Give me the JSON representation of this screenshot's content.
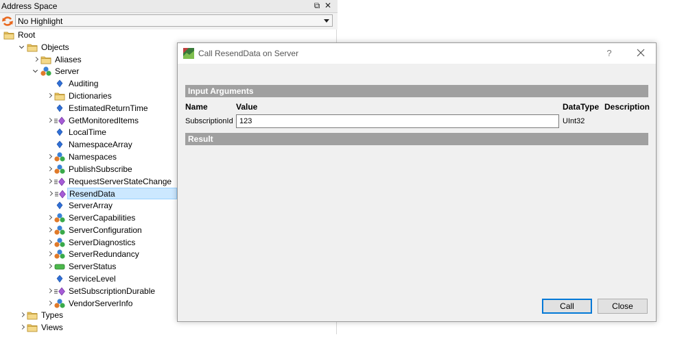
{
  "panel": {
    "title": "Address Space",
    "float_icon": "⧉",
    "close_icon": "✕",
    "highlight_value": "No Highlight"
  },
  "tree": {
    "items": [
      {
        "label": "Root",
        "icon": "folder-icon",
        "expander": "none"
      },
      {
        "label": "Objects",
        "icon": "folder-icon",
        "expander": "expanded"
      },
      {
        "label": "Aliases",
        "icon": "folder-icon",
        "expander": "collapsed"
      },
      {
        "label": "Server",
        "icon": "object-icon",
        "expander": "expanded"
      },
      {
        "label": "Auditing",
        "icon": "variable-icon",
        "expander": "none"
      },
      {
        "label": "Dictionaries",
        "icon": "folder-icon",
        "expander": "collapsed"
      },
      {
        "label": "EstimatedReturnTime",
        "icon": "variable-icon",
        "expander": "none"
      },
      {
        "label": "GetMonitoredItems",
        "icon": "method-icon",
        "expander": "collapsed"
      },
      {
        "label": "LocalTime",
        "icon": "variable-icon",
        "expander": "none"
      },
      {
        "label": "NamespaceArray",
        "icon": "variable-icon",
        "expander": "none"
      },
      {
        "label": "Namespaces",
        "icon": "object-icon",
        "expander": "collapsed"
      },
      {
        "label": "PublishSubscribe",
        "icon": "object-icon",
        "expander": "collapsed"
      },
      {
        "label": "RequestServerStateChange",
        "icon": "method-icon",
        "expander": "collapsed"
      },
      {
        "label": "ResendData",
        "icon": "method-icon",
        "expander": "collapsed",
        "selected": true
      },
      {
        "label": "ServerArray",
        "icon": "variable-icon",
        "expander": "none"
      },
      {
        "label": "ServerCapabilities",
        "icon": "object-icon",
        "expander": "collapsed"
      },
      {
        "label": "ServerConfiguration",
        "icon": "object-icon",
        "expander": "collapsed"
      },
      {
        "label": "ServerDiagnostics",
        "icon": "object-icon",
        "expander": "collapsed"
      },
      {
        "label": "ServerRedundancy",
        "icon": "object-icon",
        "expander": "collapsed"
      },
      {
        "label": "ServerStatus",
        "icon": "status-variable-icon",
        "expander": "collapsed"
      },
      {
        "label": "ServiceLevel",
        "icon": "variable-icon",
        "expander": "none"
      },
      {
        "label": "SetSubscriptionDurable",
        "icon": "method-icon",
        "expander": "collapsed"
      },
      {
        "label": "VendorServerInfo",
        "icon": "object-icon",
        "expander": "collapsed"
      },
      {
        "label": "Types",
        "icon": "folder-icon",
        "expander": "collapsed"
      },
      {
        "label": "Views",
        "icon": "folder-icon",
        "expander": "collapsed"
      }
    ]
  },
  "dialog": {
    "title": "Call ResendData on Server",
    "help": "?",
    "input_section": "Input Arguments",
    "columns": {
      "name": "Name",
      "value": "Value",
      "datatype": "DataType",
      "description": "Description"
    },
    "argument": {
      "name": "SubscriptionId",
      "value": "123",
      "datatype": "UInt32"
    },
    "result_section": "Result",
    "call_label": "Call",
    "close_label": "Close"
  },
  "colors": {
    "selection": "#cce8ff",
    "section_header": "#a0a0a0",
    "default_button_border": "#0078d7",
    "folder": "#e8c463"
  }
}
